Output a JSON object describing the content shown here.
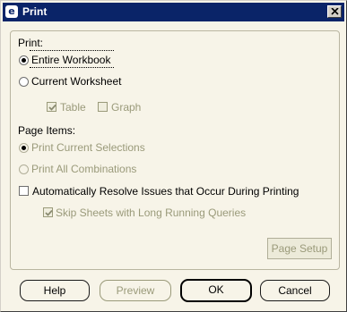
{
  "window": {
    "title": "Print"
  },
  "print_section": {
    "label": "Print:",
    "options": [
      {
        "label": "Entire Workbook",
        "checked": true
      },
      {
        "label": "Current Worksheet",
        "checked": false
      }
    ],
    "sub_options": [
      {
        "label": "Table",
        "checked": true,
        "enabled": false
      },
      {
        "label": "Graph",
        "checked": false,
        "enabled": false
      }
    ]
  },
  "page_items_section": {
    "label": "Page Items:",
    "options": [
      {
        "label": "Print Current Selections",
        "checked": true,
        "enabled": false
      },
      {
        "label": "Print All Combinations",
        "checked": false,
        "enabled": false
      }
    ]
  },
  "auto_resolve": {
    "label": "Automatically Resolve Issues that Occur During Printing",
    "checked": false
  },
  "skip_sheets": {
    "label": "Skip Sheets with Long Running Queries",
    "checked": true,
    "enabled": false
  },
  "page_setup": {
    "label": "Page Setup",
    "enabled": false
  },
  "buttons": {
    "help": "Help",
    "preview": "Preview",
    "ok": "OK",
    "cancel": "Cancel"
  }
}
